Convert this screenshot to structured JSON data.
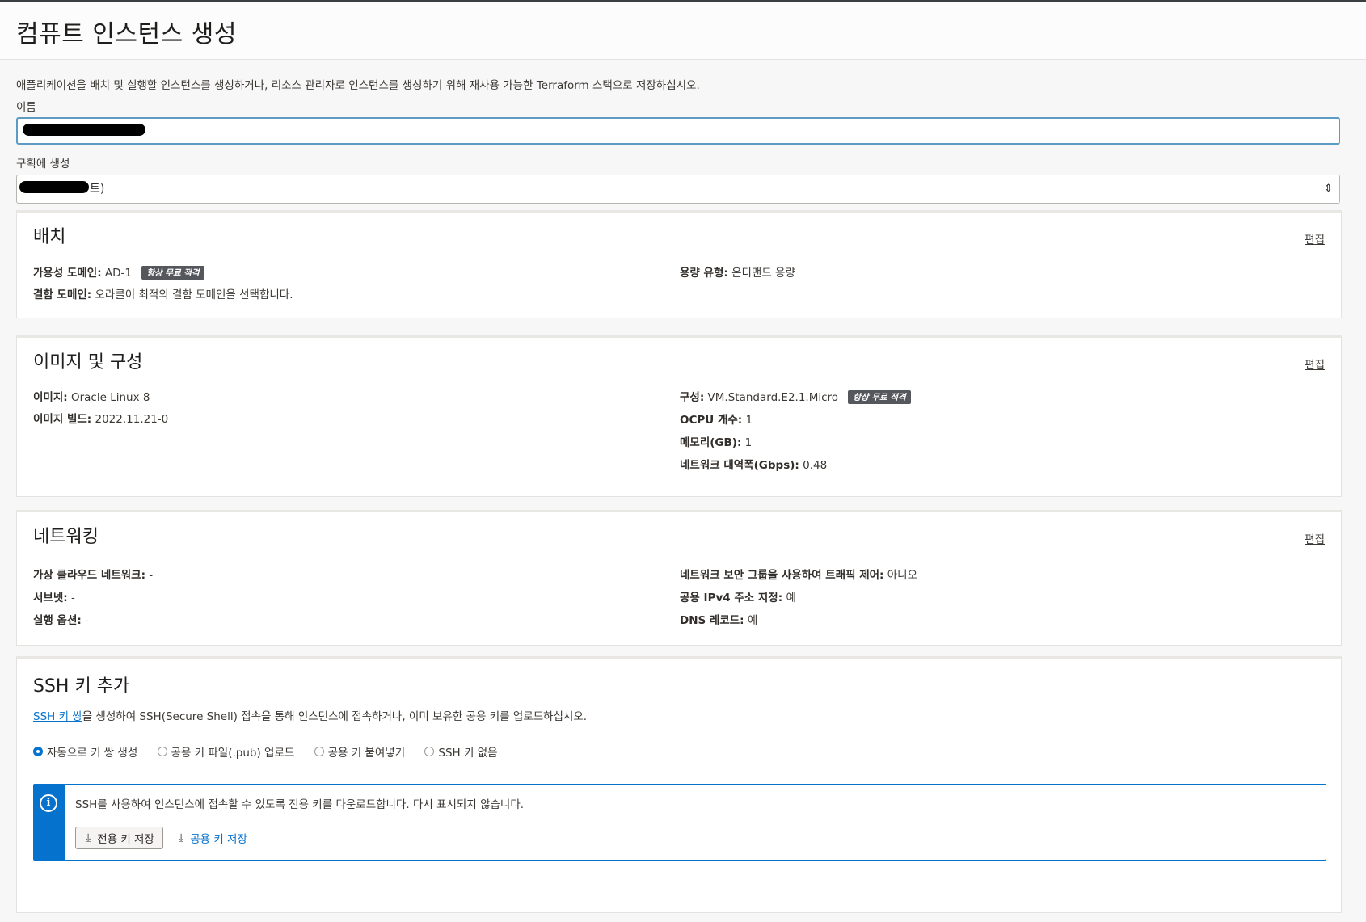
{
  "page": {
    "title": "컴퓨트 인스턴스 생성",
    "description": "애플리케이션을 배치 및 실행할 인스턴스를 생성하거나, 리소스 관리자로 인스턴스를 생성하기 위해 재사용 가능한 Terraform 스택으로 저장하십시오."
  },
  "form": {
    "name_label": "이름",
    "name_value": "",
    "compartment_label": "구획에 생성",
    "compartment_value": "트)"
  },
  "placement": {
    "title": "배치",
    "edit": "편집",
    "availability_domain_label": "가용성 도메인:",
    "availability_domain_value": "AD-1",
    "always_free_badge": "항상 무료 적격",
    "fault_domain_label": "결함 도메인:",
    "fault_domain_value": "오라클이 최적의 결함 도메인을 선택합니다.",
    "capacity_type_label": "용량 유형:",
    "capacity_type_value": "온디맨드 용량"
  },
  "image": {
    "title": "이미지 및 구성",
    "edit": "편집",
    "image_label": "이미지:",
    "image_value": "Oracle Linux 8",
    "build_label": "이미지 빌드:",
    "build_value": "2022.11.21-0",
    "shape_label": "구성:",
    "shape_value": "VM.Standard.E2.1.Micro",
    "always_free_badge": "항상 무료 적격",
    "ocpu_label": "OCPU 개수:",
    "ocpu_value": "1",
    "memory_label": "메모리(GB):",
    "memory_value": "1",
    "bandwidth_label": "네트워크 대역폭(Gbps):",
    "bandwidth_value": "0.48"
  },
  "networking": {
    "title": "네트워킹",
    "edit": "편집",
    "vcn_label": "가상 클라우드 네트워크:",
    "vcn_value": "-",
    "subnet_label": "서브넷:",
    "subnet_value": "-",
    "launch_options_label": "실행 옵션:",
    "launch_options_value": "-",
    "nsg_label": "네트워크 보안 그룹을 사용하여 트래픽 제어:",
    "nsg_value": "아니오",
    "public_ip_label": "공용 IPv4 주소 지정:",
    "public_ip_value": "예",
    "dns_label": "DNS 레코드:",
    "dns_value": "예"
  },
  "ssh": {
    "title": "SSH 키 추가",
    "desc_link": "SSH 키 쌍",
    "desc_rest": "을 생성하여 SSH(Secure Shell) 접속을 통해 인스턴스에 접속하거나, 이미 보유한 공용 키를 업로드하십시오.",
    "options": [
      {
        "label": "자동으로 키 쌍 생성",
        "selected": true
      },
      {
        "label": "공용 키 파일(.pub) 업로드",
        "selected": false
      },
      {
        "label": "공용 키 붙여넣기",
        "selected": false
      },
      {
        "label": "SSH 키 없음",
        "selected": false
      }
    ],
    "info_text": "SSH를 사용하여 인스턴스에 접속할 수 있도록 전용 키를 다운로드합니다. 다시 표시되지 않습니다.",
    "save_private": "전용 키 저장",
    "save_public": "공용 키 저장"
  },
  "colors": {
    "accent": "#0572ce",
    "badge": "#54585d",
    "input_focus": "#5d9bc4"
  }
}
